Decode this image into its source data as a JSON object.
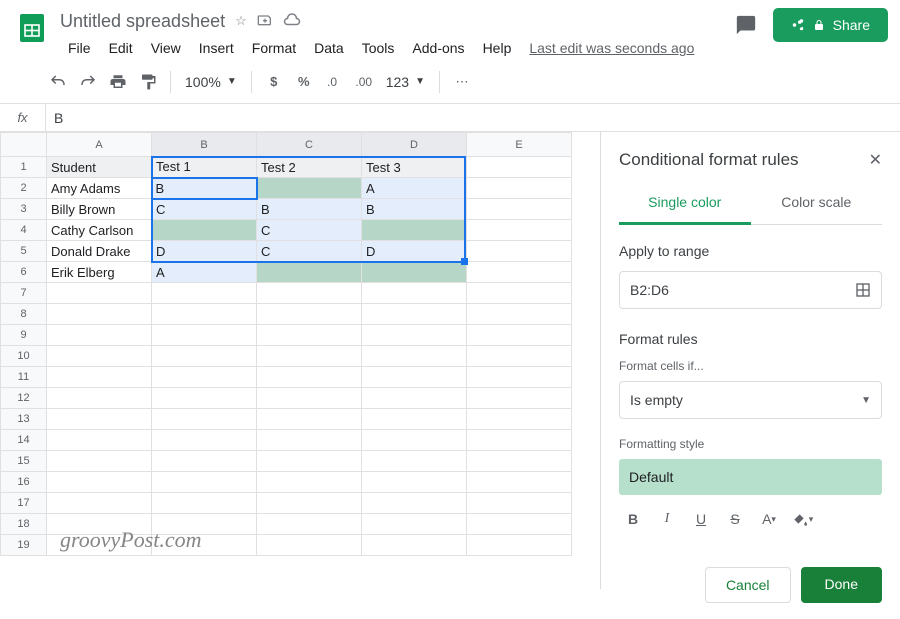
{
  "header": {
    "title": "Untitled spreadsheet",
    "last_edit": "Last edit was seconds ago",
    "share": "Share",
    "menu": [
      "File",
      "Edit",
      "View",
      "Insert",
      "Format",
      "Data",
      "Tools",
      "Add-ons",
      "Help"
    ]
  },
  "toolbar": {
    "zoom": "100%",
    "format_num": "123"
  },
  "formula": {
    "fx": "fx",
    "value": "B"
  },
  "grid": {
    "columns": [
      "A",
      "B",
      "C",
      "D",
      "E"
    ],
    "headers": [
      "Student",
      "Test 1",
      "Test 2",
      "Test 3"
    ],
    "rows": [
      {
        "student": "Amy Adams",
        "t1": "B",
        "t2": "",
        "t3": "A"
      },
      {
        "student": "Billy Brown",
        "t1": "C",
        "t2": "B",
        "t3": "B"
      },
      {
        "student": "Cathy Carlson",
        "t1": "",
        "t2": "C",
        "t3": ""
      },
      {
        "student": "Donald Drake",
        "t1": "D",
        "t2": "C",
        "t3": "D"
      },
      {
        "student": "Erik Elberg",
        "t1": "A",
        "t2": "",
        "t3": ""
      }
    ],
    "green_cells": [
      "B4",
      "B6",
      "C2",
      "C6",
      "D4",
      "D6"
    ],
    "active_cell": "B2",
    "selection": "B2:D6"
  },
  "panel": {
    "title": "Conditional format rules",
    "tabs": {
      "single": "Single color",
      "scale": "Color scale"
    },
    "apply_range_label": "Apply to range",
    "range_value": "B2:D6",
    "format_rules_label": "Format rules",
    "cells_if_label": "Format cells if...",
    "rule_value": "Is empty",
    "style_label": "Formatting style",
    "style_preview": "Default",
    "cancel": "Cancel",
    "done": "Done"
  },
  "watermark": "groovyPost.com"
}
